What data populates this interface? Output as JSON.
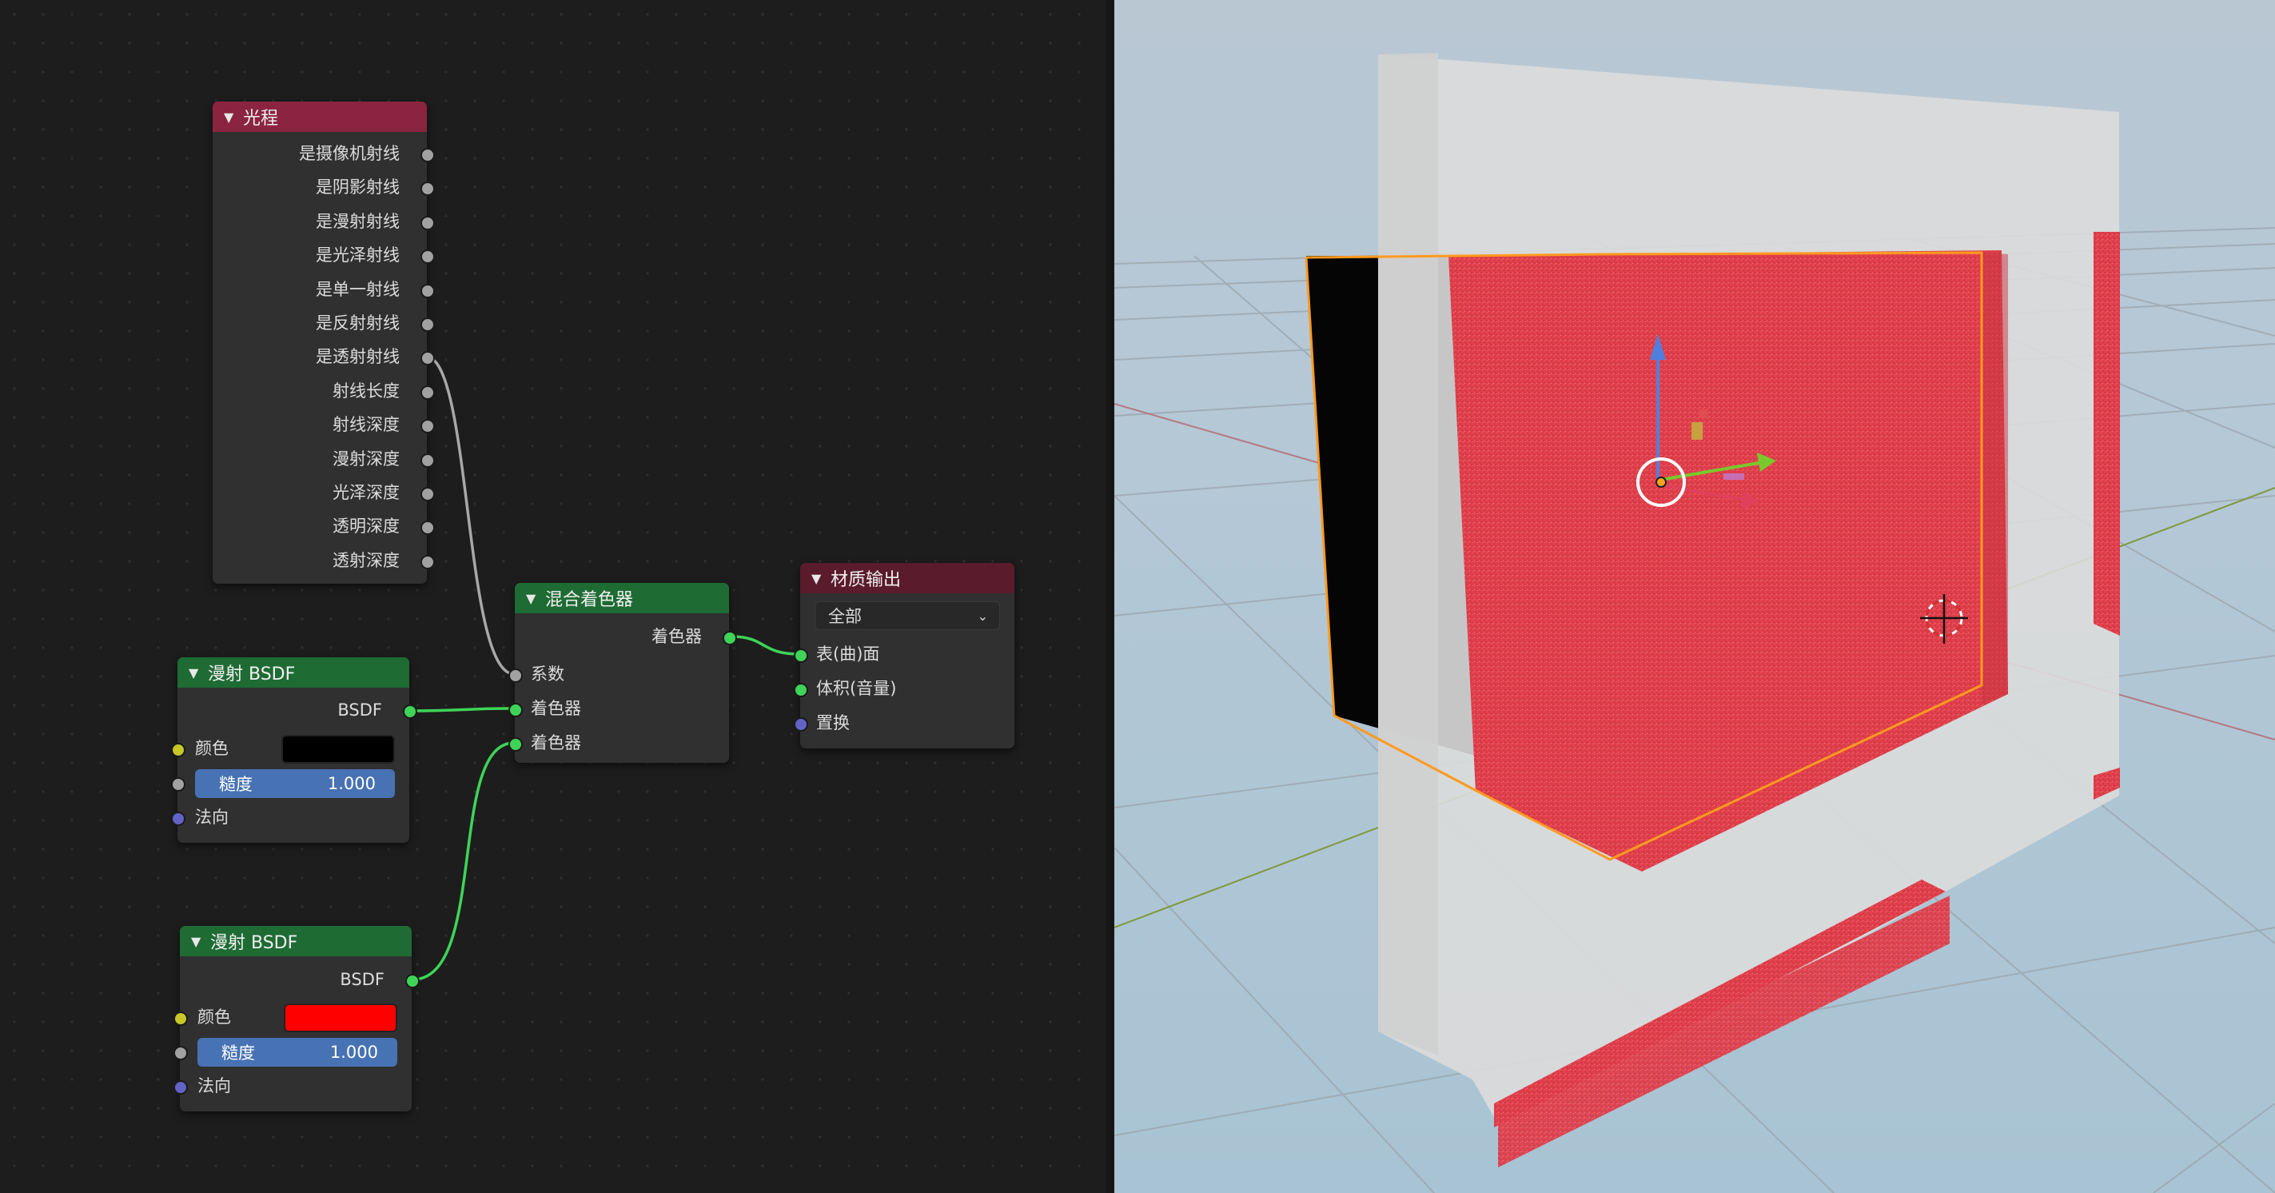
{
  "light_path_node": {
    "title": "光程",
    "outputs": [
      "是摄像机射线",
      "是阴影射线",
      "是漫射射线",
      "是光泽射线",
      "是单一射线",
      "是反射射线",
      "是透射射线",
      "射线长度",
      "射线深度",
      "漫射深度",
      "光泽深度",
      "透明深度",
      "透射深度"
    ]
  },
  "diffuse_node_1": {
    "title": "漫射 BSDF",
    "output": "BSDF",
    "color_label": "颜色",
    "color_value": "#000000",
    "roughness_label": "糙度",
    "roughness_value": "1.000",
    "normal_label": "法向"
  },
  "diffuse_node_2": {
    "title": "漫射 BSDF",
    "output": "BSDF",
    "color_label": "颜色",
    "color_value": "#ff0000",
    "roughness_label": "糙度",
    "roughness_value": "1.000",
    "normal_label": "法向"
  },
  "mix_shader_node": {
    "title": "混合着色器",
    "output": "着色器",
    "inputs": [
      "系数",
      "着色器",
      "着色器"
    ]
  },
  "material_output_node": {
    "title": "材质输出",
    "target": "全部",
    "inputs": [
      "表(曲)面",
      "体积(音量)",
      "置换"
    ]
  },
  "colors": {
    "header_input": "#8a2440",
    "header_shader": "#1e6b33",
    "header_output": "#5a1b2c",
    "shader_socket": "#3ed458",
    "selection_outline": "#ff9a1f",
    "object_red": "#e0404c"
  },
  "icons": {
    "collapse": "chevron-down-icon",
    "dropdown": "chevron-down-icon",
    "cursor": "3d-cursor-icon",
    "gizmo": "transform-gizmo-icon"
  }
}
